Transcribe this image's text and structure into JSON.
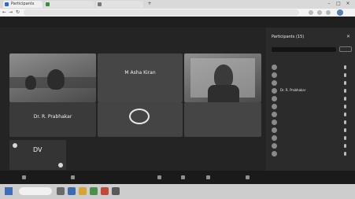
{
  "browser": {
    "tabs": [
      {
        "label": "Participants"
      },
      {
        "label": ""
      },
      {
        "label": ""
      }
    ],
    "new_tab": "+",
    "url": "",
    "nav": {
      "back": "←",
      "forward": "→",
      "reload": "↻"
    },
    "window": {
      "min": "–",
      "max": "□",
      "close": "✕"
    }
  },
  "meeting": {
    "title": "",
    "top_buttons": {
      "chat": "",
      "leave": ""
    }
  },
  "tiles": [
    {
      "name": "Dr. R. Prabhakar",
      "subtitle": "",
      "type": "video"
    },
    {
      "name": "M Asha Kiran",
      "subtitle": "",
      "type": "avatar"
    },
    {
      "name": "",
      "subtitle": "",
      "type": "video"
    },
    {
      "name": "",
      "subtitle": "",
      "type": "logo"
    },
    {
      "name": "",
      "subtitle": "",
      "type": "avatar"
    }
  ],
  "self_view": {
    "initials": "DV",
    "name": ""
  },
  "panel": {
    "title": "Participants (15)",
    "section": "",
    "participants": [
      {
        "name": "",
        "role": ""
      },
      {
        "name": "",
        "role": ""
      },
      {
        "name": "",
        "role": ""
      },
      {
        "name": "Dr. R. Prabhakar",
        "role": ""
      },
      {
        "name": "",
        "role": ""
      },
      {
        "name": "",
        "role": ""
      },
      {
        "name": "",
        "role": ""
      },
      {
        "name": "",
        "role": ""
      },
      {
        "name": "",
        "role": ""
      },
      {
        "name": "",
        "role": ""
      },
      {
        "name": "",
        "role": ""
      },
      {
        "name": "",
        "role": ""
      }
    ],
    "footer_left": "",
    "footer_right": ""
  },
  "controls": {
    "mute": "",
    "video": "",
    "share": "",
    "record": "",
    "reactions": "",
    "more": ""
  },
  "taskbar": {
    "search": "",
    "time": "",
    "date": ""
  },
  "colors": {
    "meeting_bg": "#242424",
    "panel_bg": "#2b2b2b",
    "taskbar": "#cdcdcd"
  }
}
